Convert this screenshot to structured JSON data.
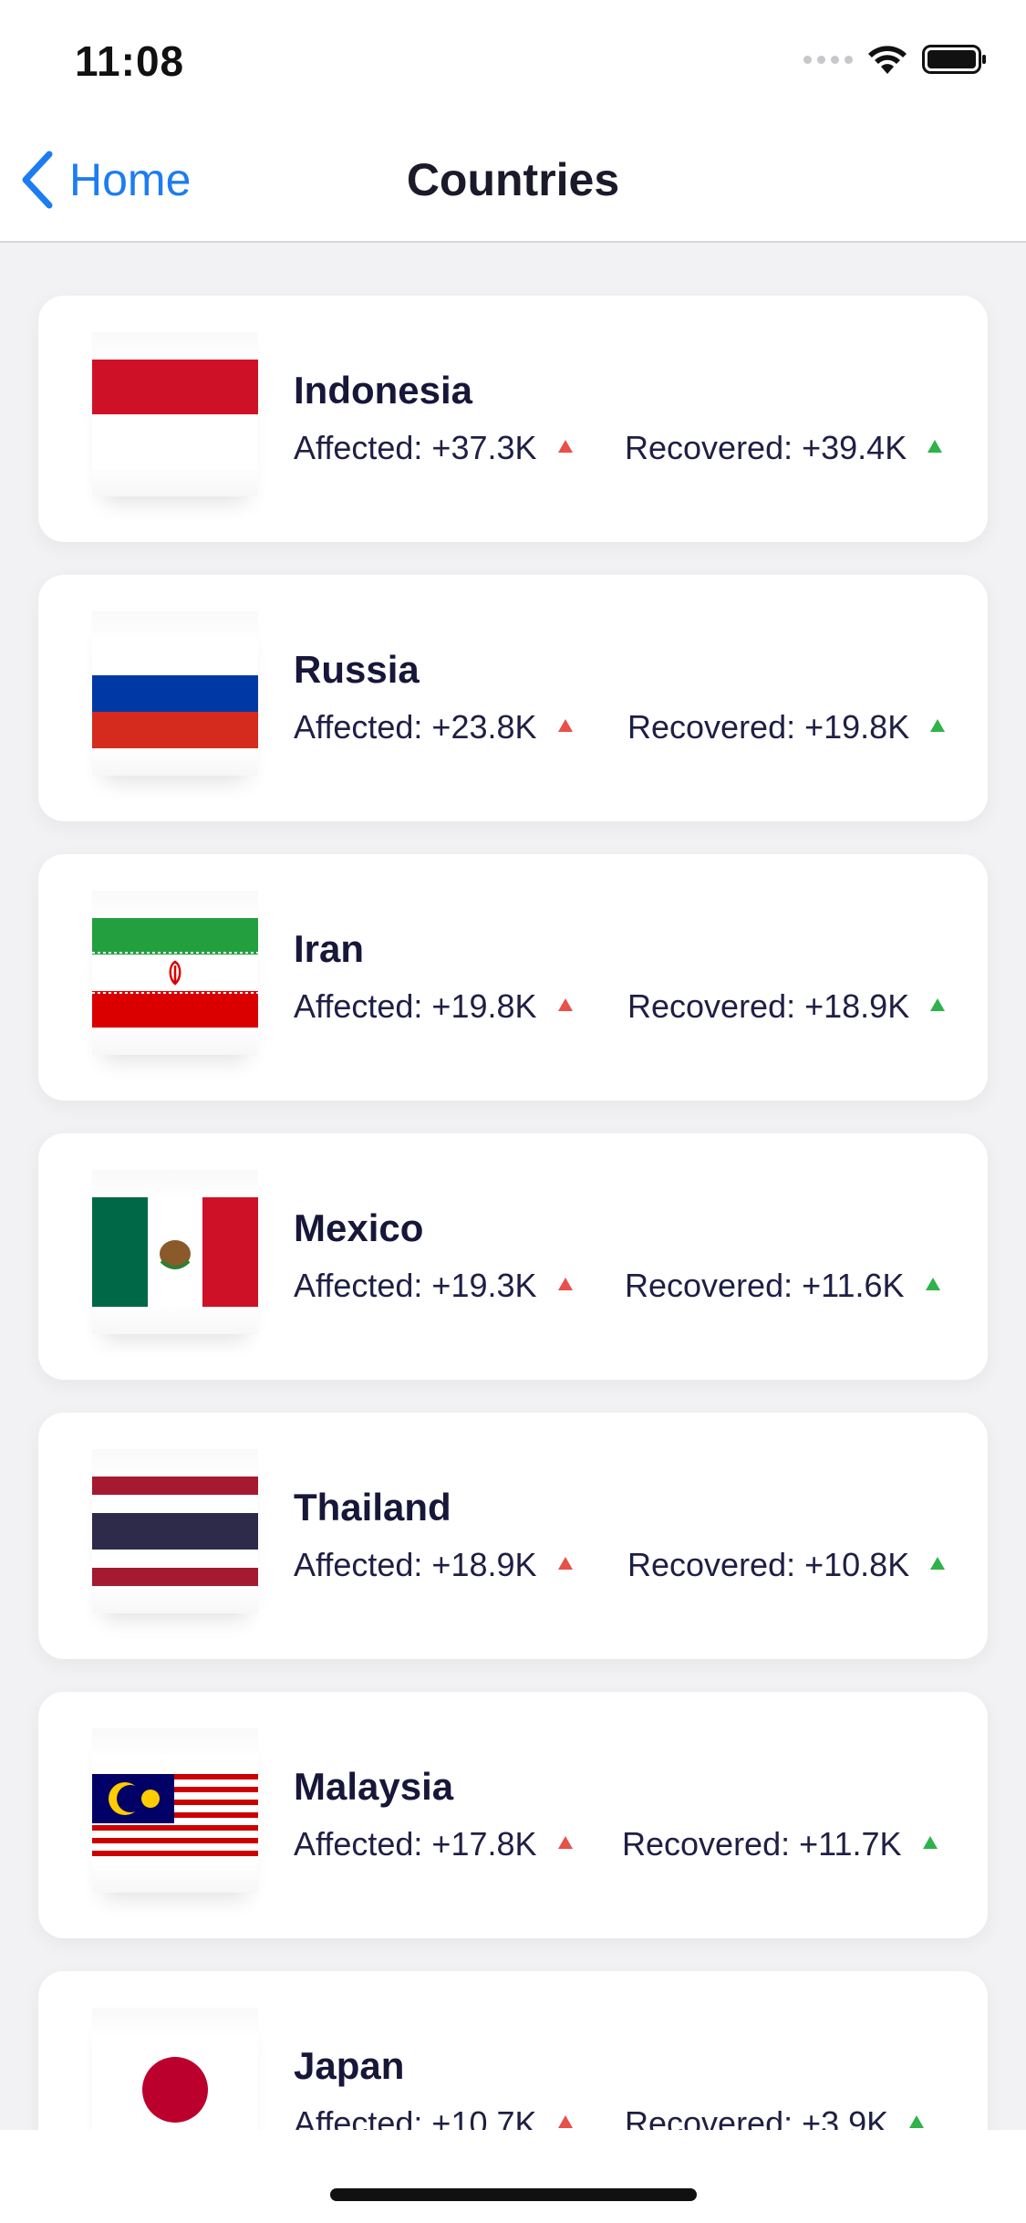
{
  "status_bar": {
    "time": "11:08"
  },
  "nav": {
    "back_label": "Home",
    "title": "Countries"
  },
  "colors": {
    "accent": "#1d7cf2",
    "affected_arrow": "#e8504a",
    "recovered_arrow": "#2fb24b"
  },
  "countries": [
    {
      "name": "Indonesia",
      "affected": "Affected: +37.3K",
      "recovered": "Recovered: +39.4K",
      "flag_icon": "indonesia-flag-icon"
    },
    {
      "name": "Russia",
      "affected": "Affected: +23.8K",
      "recovered": "Recovered: +19.8K",
      "flag_icon": "russia-flag-icon"
    },
    {
      "name": "Iran",
      "affected": "Affected: +19.8K",
      "recovered": "Recovered: +18.9K",
      "flag_icon": "iran-flag-icon"
    },
    {
      "name": "Mexico",
      "affected": "Affected: +19.3K",
      "recovered": "Recovered: +11.6K",
      "flag_icon": "mexico-flag-icon"
    },
    {
      "name": "Thailand",
      "affected": "Affected: +18.9K",
      "recovered": "Recovered: +10.8K",
      "flag_icon": "thailand-flag-icon"
    },
    {
      "name": "Malaysia",
      "affected": "Affected: +17.8K",
      "recovered": "Recovered: +11.7K",
      "flag_icon": "malaysia-flag-icon"
    },
    {
      "name": "Japan",
      "affected": "Affected: +10.7K",
      "recovered": "Recovered: +3.9K",
      "flag_icon": "japan-flag-icon"
    }
  ]
}
